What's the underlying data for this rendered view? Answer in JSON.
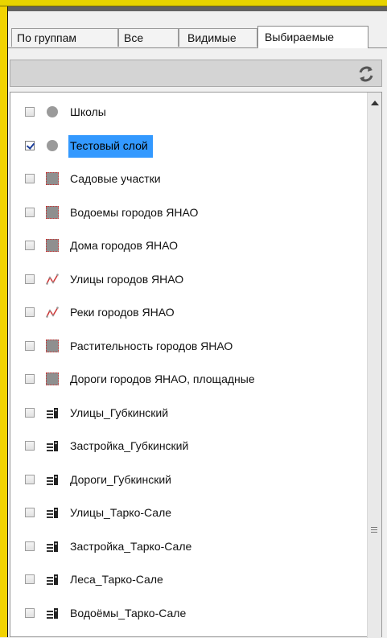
{
  "tabs": [
    {
      "label": "По группам",
      "active": false
    },
    {
      "label": "Все",
      "active": false
    },
    {
      "label": "Видимые",
      "active": false
    },
    {
      "label": "Выбираемые",
      "active": true
    }
  ],
  "toolbar": {
    "refresh_icon": "refresh-icon"
  },
  "layers": [
    {
      "label": "Школы",
      "checked": false,
      "icon": "point-icon",
      "selected": false
    },
    {
      "label": "Тестовый слой",
      "checked": true,
      "icon": "point-icon",
      "selected": true
    },
    {
      "label": "Садовые участки",
      "checked": false,
      "icon": "polygon-icon",
      "selected": false
    },
    {
      "label": "Водоемы городов ЯНАО",
      "checked": false,
      "icon": "polygon-icon",
      "selected": false
    },
    {
      "label": "Дома городов ЯНАО",
      "checked": false,
      "icon": "polygon-icon",
      "selected": false
    },
    {
      "label": "Улицы городов ЯНАО",
      "checked": false,
      "icon": "line-icon",
      "selected": false
    },
    {
      "label": "Реки городов ЯНАО",
      "checked": false,
      "icon": "line-icon",
      "selected": false
    },
    {
      "label": "Растительность городов ЯНАО",
      "checked": false,
      "icon": "polygon-icon",
      "selected": false
    },
    {
      "label": "Дороги городов ЯНАО, площадные",
      "checked": false,
      "icon": "polygon-icon",
      "selected": false
    },
    {
      "label": "Улицы_Губкинский",
      "checked": false,
      "icon": "layer-group-icon",
      "selected": false
    },
    {
      "label": "Застройка_Губкинский",
      "checked": false,
      "icon": "layer-group-icon",
      "selected": false
    },
    {
      "label": "Дороги_Губкинский",
      "checked": false,
      "icon": "layer-group-icon",
      "selected": false
    },
    {
      "label": "Улицы_Тарко-Сале",
      "checked": false,
      "icon": "layer-group-icon",
      "selected": false
    },
    {
      "label": "Застройка_Тарко-Сале",
      "checked": false,
      "icon": "layer-group-icon",
      "selected": false
    },
    {
      "label": "Леса_Тарко-Сале",
      "checked": false,
      "icon": "layer-group-icon",
      "selected": false
    },
    {
      "label": "Водоёмы_Тарко-Сале",
      "checked": false,
      "icon": "layer-group-icon",
      "selected": false
    }
  ],
  "colors": {
    "selection": "#3399ff",
    "accent_frame": "#f2d300",
    "line_icon": "#cc3333"
  }
}
